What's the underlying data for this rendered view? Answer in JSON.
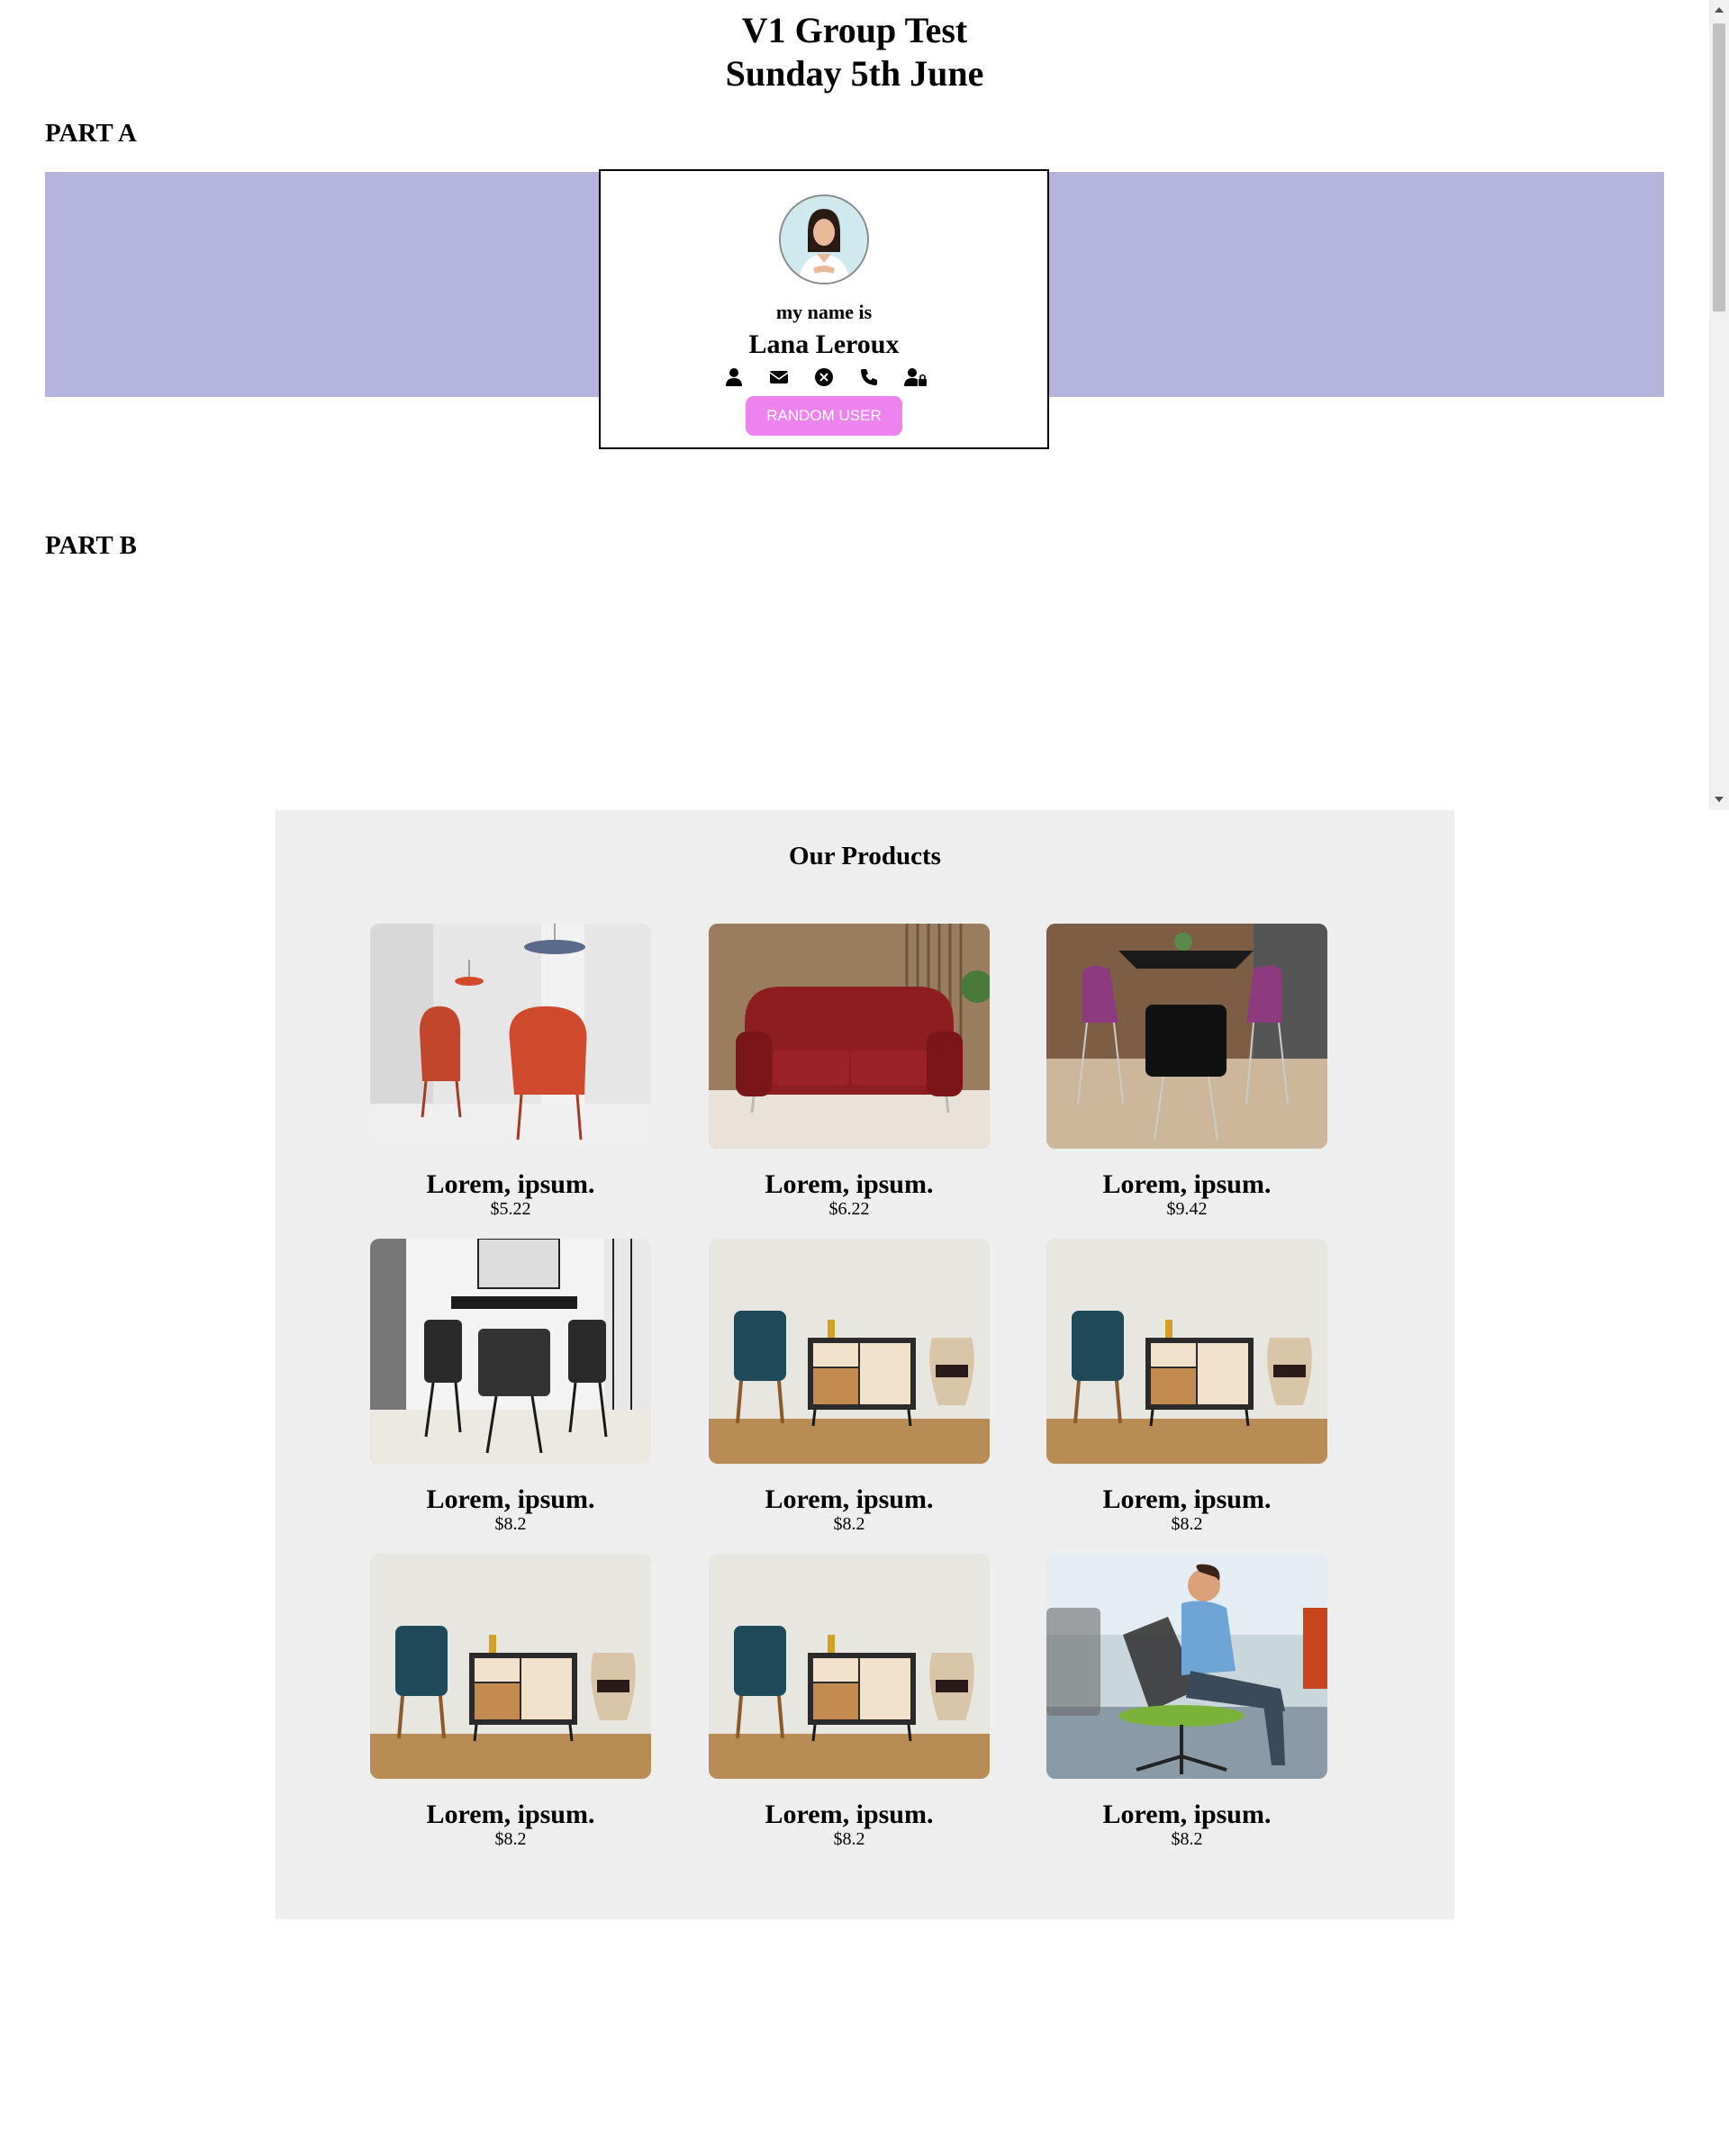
{
  "header": {
    "title_line1": "V1 Group Test",
    "title_line2": "Sunday 5th June"
  },
  "part_a": {
    "heading": "PART A",
    "card": {
      "label": "my name is",
      "name": "Lana Leroux",
      "icons": [
        "user-icon",
        "envelope-icon",
        "calendar-icon",
        "phone-icon",
        "user-lock-icon"
      ],
      "button_label": "RANDOM USER",
      "colors": {
        "banner": "#b5b4dc",
        "button": "#ee82ee"
      }
    }
  },
  "part_b": {
    "heading": "PART B"
  },
  "products": {
    "title": "Our Products",
    "items": [
      {
        "name": "Lorem, ipsum.",
        "price": "$5.22",
        "image": "red-armchairs"
      },
      {
        "name": "Lorem, ipsum.",
        "price": "$6.22",
        "image": "red-leather-sofa"
      },
      {
        "name": "Lorem, ipsum.",
        "price": "$9.42",
        "image": "purple-dining-set"
      },
      {
        "name": "Lorem, ipsum.",
        "price": "$8.2",
        "image": "black-dining-set"
      },
      {
        "name": "Lorem, ipsum.",
        "price": "$8.2",
        "image": "chair-and-sideboard"
      },
      {
        "name": "Lorem, ipsum.",
        "price": "$8.2",
        "image": "chair-and-sideboard"
      },
      {
        "name": "Lorem, ipsum.",
        "price": "$8.2",
        "image": "chair-and-sideboard"
      },
      {
        "name": "Lorem, ipsum.",
        "price": "$8.2",
        "image": "chair-and-sideboard"
      },
      {
        "name": "Lorem, ipsum.",
        "price": "$8.2",
        "image": "man-in-office-chair"
      }
    ]
  }
}
